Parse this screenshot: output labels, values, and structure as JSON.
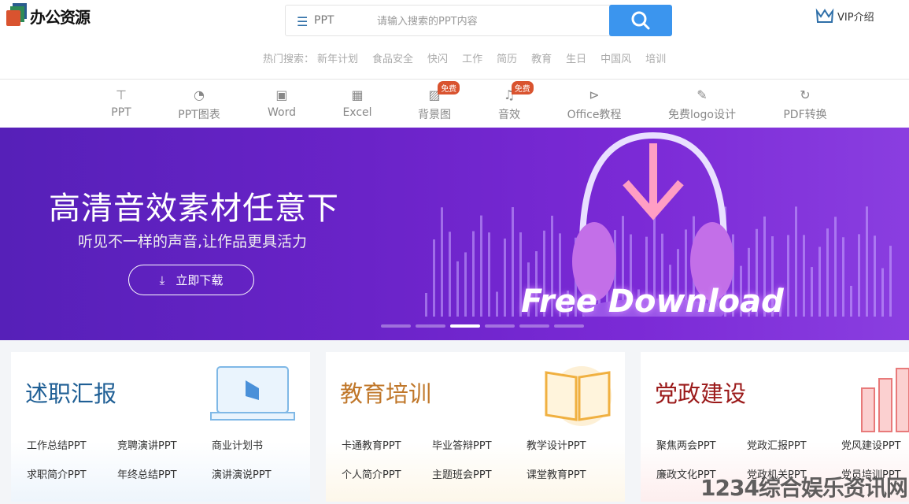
{
  "logo": {
    "text": "办公资源"
  },
  "search": {
    "type": "PPT",
    "placeholder": "请输入搜索的PPT内容"
  },
  "vip": {
    "label": "VIP介绍"
  },
  "hot": {
    "label": "热门搜索：",
    "terms": [
      "新年计划",
      "食品安全",
      "快闪",
      "工作",
      "简历",
      "教育",
      "生日",
      "中国风",
      "培训"
    ]
  },
  "nav": [
    {
      "label": "PPT",
      "icon": "presentation-icon"
    },
    {
      "label": "PPT图表",
      "icon": "pie-chart-icon"
    },
    {
      "label": "Word",
      "icon": "word-doc-icon"
    },
    {
      "label": "Excel",
      "icon": "spreadsheet-icon"
    },
    {
      "label": "背景图",
      "icon": "image-icon",
      "badge": "免费"
    },
    {
      "label": "音效",
      "icon": "music-note-icon",
      "badge": "免费"
    },
    {
      "label": "Office教程",
      "icon": "play-circle-icon"
    },
    {
      "label": "免费logo设计",
      "icon": "edit-icon"
    },
    {
      "label": "PDF转换",
      "icon": "refresh-icon"
    }
  ],
  "banner": {
    "title": "高清音效素材任意下",
    "subtitle": "听见不一样的声音,让作品更具活力",
    "button": "立即下载",
    "art_text": "Free Download",
    "active_slide": 3,
    "slides": 6
  },
  "cards": [
    {
      "title": "述职汇报",
      "color": "#1f5f95",
      "links": [
        "工作总结PPT",
        "竞聘演讲PPT",
        "商业计划书",
        "求职简介PPT",
        "年终总结PPT",
        "演讲演说PPT"
      ]
    },
    {
      "title": "教育培训",
      "color": "#c0772a",
      "links": [
        "卡通教育PPT",
        "毕业答辩PPT",
        "教学设计PPT",
        "个人简介PPT",
        "主题班会PPT",
        "课堂教育PPT"
      ]
    },
    {
      "title": "党政建设",
      "color": "#9b1a1a",
      "links": [
        "聚焦两会PPT",
        "党政汇报PPT",
        "党风建设PPT",
        "廉政文化PPT",
        "党政机关PPT",
        "党员培训PPT"
      ]
    }
  ],
  "watermark": "1234综合娱乐资讯网"
}
